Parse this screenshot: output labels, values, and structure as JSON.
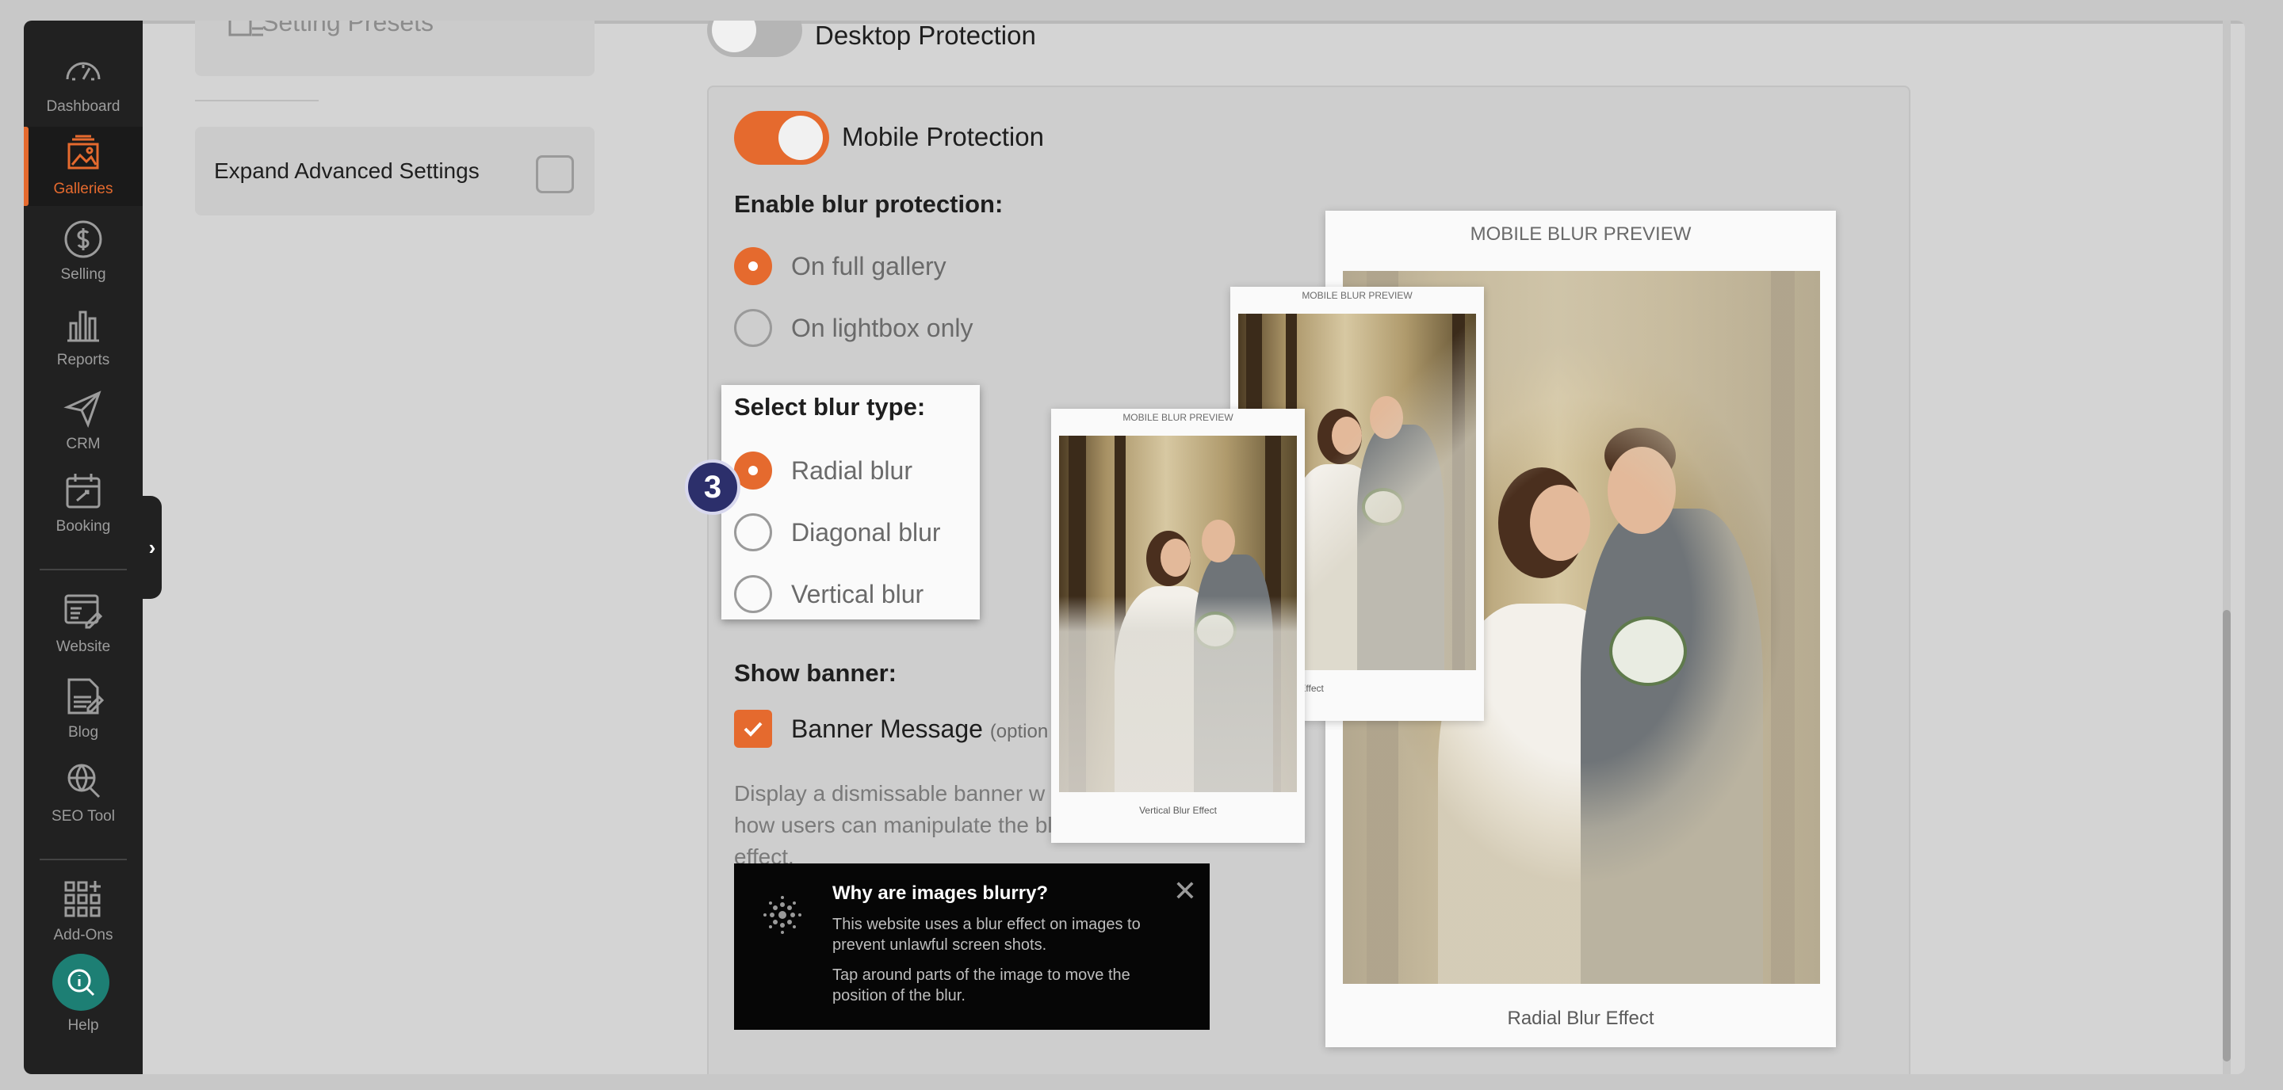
{
  "sidebar": {
    "items": [
      {
        "label": "Dashboard",
        "icon": "gauge-icon"
      },
      {
        "label": "Galleries",
        "icon": "image-stack-icon",
        "active": true
      },
      {
        "label": "Selling",
        "icon": "dollar-icon"
      },
      {
        "label": "Reports",
        "icon": "bar-chart-icon"
      },
      {
        "label": "CRM",
        "icon": "paper-plane-icon"
      },
      {
        "label": "Booking",
        "icon": "calendar-icon"
      },
      {
        "label": "Website",
        "icon": "website-edit-icon"
      },
      {
        "label": "Blog",
        "icon": "blog-doc-icon"
      },
      {
        "label": "SEO Tool",
        "icon": "seo-globe-icon"
      },
      {
        "label": "Add-Ons",
        "icon": "grid-plus-icon"
      }
    ],
    "help_label": "Help",
    "accent": "#e56a2e"
  },
  "left_panel": {
    "presets_label": "Setting Presets",
    "expand_label": "Expand Advanced Settings"
  },
  "protection": {
    "desktop_label": "Desktop Protection",
    "mobile_label": "Mobile Protection",
    "enable_blur_heading": "Enable blur protection:",
    "enable_options": [
      "On full gallery",
      "On lightbox only"
    ],
    "blur_type_heading": "Select blur type:",
    "blur_type_options": [
      "Radial blur",
      "Diagonal blur",
      "Vertical blur"
    ],
    "step_badge": "3",
    "show_banner_heading": "Show banner:",
    "banner_message_label": "Banner Message",
    "banner_optional": "(option",
    "banner_desc": "Display a dismissable banner w on how users can manipulate the blur effect."
  },
  "banner_preview": {
    "title": "Why are images blurry?",
    "p1": "This website uses a blur effect on images to prevent unlawful screen shots.",
    "p2": "Tap around parts of the image to move the position of the blur.",
    "close": "✕"
  },
  "previews": {
    "header": "MOBILE BLUR PREVIEW",
    "radial_caption": "Radial Blur Effect",
    "diagonal_caption": "Diagonal Blur Effect",
    "vertical_caption": "Vertical Blur Effect"
  }
}
